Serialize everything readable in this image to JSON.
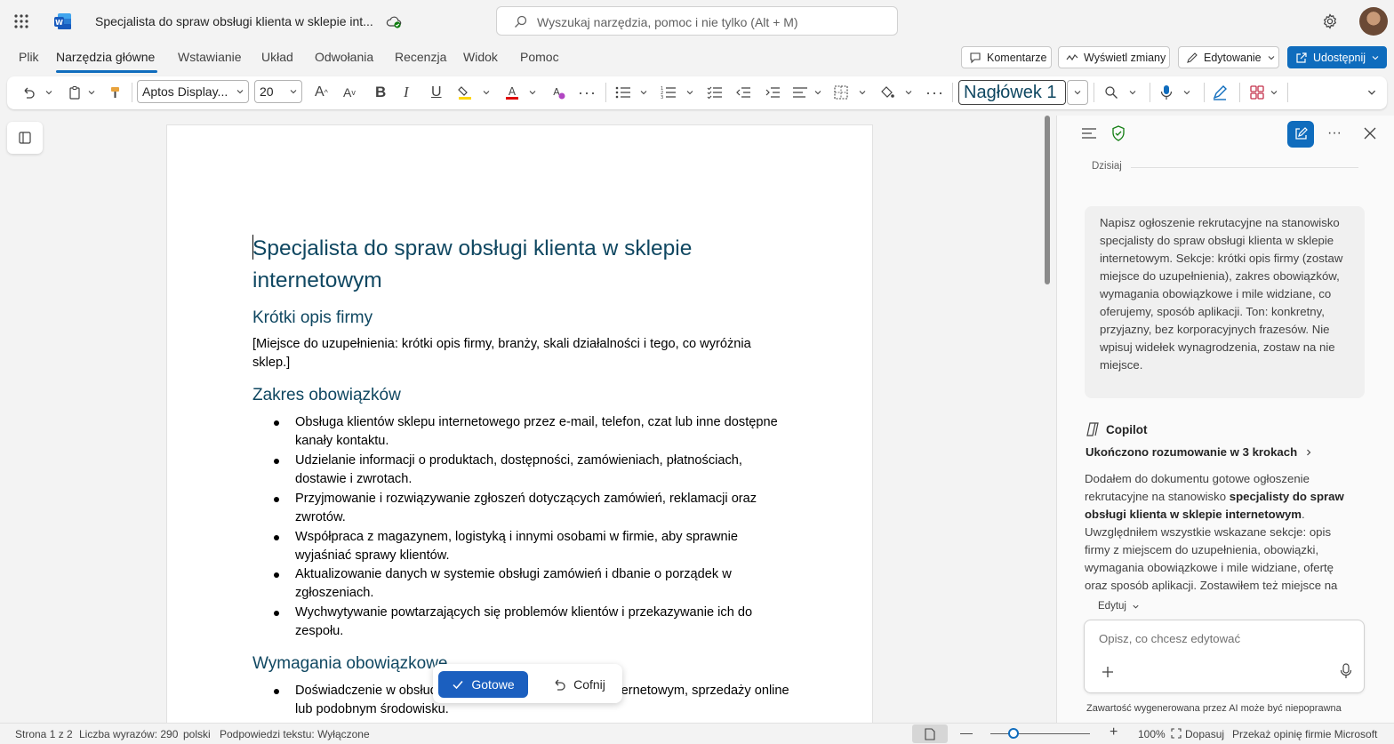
{
  "titlebar": {
    "doc_title": "Specjalista do spraw obsługi klienta w sklepie int...",
    "search_placeholder": "Wyszukaj narzędzia, pomoc i nie tylko (Alt + M)"
  },
  "menu": {
    "tabs": [
      "Plik",
      "Narzędzia główne",
      "Wstawianie",
      "Układ",
      "Odwołania",
      "Recenzja",
      "Widok",
      "Pomoc"
    ],
    "active_tab": "Narzędzia główne",
    "comments": "Komentarze",
    "show_changes": "Wyświetl zmiany",
    "editing": "Edytowanie",
    "share": "Udostępnij"
  },
  "ribbon": {
    "font_name": "Aptos Display...",
    "font_size": "20",
    "style": "Nagłówek 1"
  },
  "document": {
    "title": "Specjalista do spraw obsługi klienta w sklepie internetowym",
    "section1_heading": "Krótki opis firmy",
    "section1_text": "[Miejsce do uzupełnienia: krótki opis firmy, branży, skali działalności i tego, co wyróżnia sklep.]",
    "section2_heading": "Zakres obowiązków",
    "duties": [
      "Obsługa klientów sklepu internetowego przez e-mail, telefon, czat lub inne dostępne kanały kontaktu.",
      "Udzielanie informacji o produktach, dostępności, zamówieniach, płatnościach, dostawie i zwrotach.",
      "Przyjmowanie i rozwiązywanie zgłoszeń dotyczących zamówień, reklamacji oraz zwrotów.",
      "Współpraca z magazynem, logistyką i innymi osobami w firmie, aby sprawnie wyjaśniać sprawy klientów.",
      "Aktualizowanie danych w systemie obsługi zamówień i dbanie o porządek w zgłoszeniach.",
      "Wychwytywanie powtarzających się problemów klientów i przekazywanie ich do zespołu."
    ],
    "section3_heading": "Wymagania obowiązkowe",
    "requirements": [
      "Doświadczenie w obsłudze klienta, najlepiej w sklepie internetowym, sprzedaży online lub podobnym środowisku."
    ]
  },
  "floatbar": {
    "done": "Gotowe",
    "undo": "Cofnij"
  },
  "copilot": {
    "date_label": "Dzisiaj",
    "user_prompt": "Napisz ogłoszenie rekrutacyjne na stanowisko specjalisty do spraw obsługi klienta w sklepie internetowym. Sekcje: krótki opis firmy (zostaw miejsce do uzupełnienia), zakres obowiązków, wymagania obowiązkowe i mile widziane, co oferujemy, sposób aplikacji. Ton: konkretny, przyjazny, bez korporacyjnych frazesów. Nie wpisuj widełek wynagrodzenia, zostaw na nie miejsce.",
    "assistant_name": "Copilot",
    "reasoning": "Ukończono rozumowanie w 3 krokach",
    "reply_intro": "Dodałem do dokumentu gotowe ogłoszenie rekrutacyjne na stanowisko ",
    "reply_bold": "specjalisty do spraw obsługi klienta w sklepie internetowym",
    "reply_rest": ". Uwzględniłem wszystkie wskazane sekcje: opis firmy z miejscem do uzupełnienia, obowiązki, wymagania obowiązkowe i mile widziane, ofertę oraz sposób aplikacji. Zostawiłem też miejsce na",
    "edit_label": "Edytuj",
    "input_placeholder": "Opisz, co chcesz edytować",
    "disclaimer": "Zawartość wygenerowana przez AI może być niepoprawna"
  },
  "statusbar": {
    "page": "Strona 1 z 2",
    "words": "Liczba wyrazów: 290",
    "language": "polski",
    "text_predictions": "Podpowiedzi tekstu: Wyłączone",
    "zoom": "100%",
    "fit": "Dopasuj",
    "feedback": "Przekaż opinię firmie Microsoft"
  },
  "colors": {
    "accent": "#0f6cbd",
    "heading": "#0f4761",
    "share_button": "#0f6cbd",
    "done_button": "#1b5fbf"
  }
}
